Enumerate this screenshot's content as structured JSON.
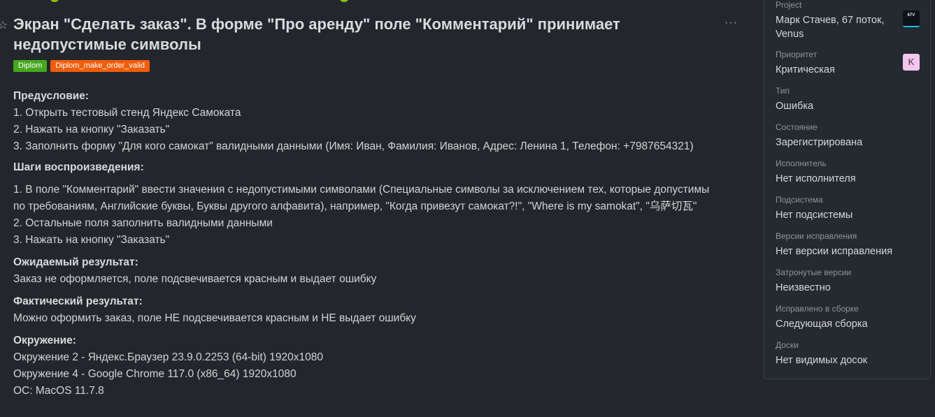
{
  "issue": {
    "title": "Экран \"Сделать заказ\". В форме \"Про аренду\" поле \"Комментарий\" принимает недопустимые символы",
    "more_label": "···",
    "tags": [
      {
        "label": "Diplom",
        "color": "#46a81e"
      },
      {
        "label": "Diplom_make_order_valid",
        "color": "#ef5d0b"
      }
    ]
  },
  "description": {
    "precondition_heading": "Предусловие:",
    "precondition": [
      "1. Открыть тестовый стенд Яндекс Самоката",
      "2. Нажать на кнопку \"Заказать\"",
      "3. Заполнить форму \"Для кого самокат\" валидными данными (Имя: Иван, Фамилия: Иванов, Адрес: Ленина 1, Телефон: +7987654321)"
    ],
    "steps_heading": "Шаги воспроизведения:",
    "steps": [
      "1. В поле \"Комментарий\" ввести значения с недопустимыми символами (Специальные символы за исключением тех, которые допустимы по требованиям, Английские буквы, Буквы другого алфавита), например, \"Когда привезут самокат?!\", \"Where is my samokat\", \"乌萨切瓦\"",
      "2. Остальные поля заполнить валидными данными",
      "3. Нажать на кнопку \"Заказать\""
    ],
    "expected_heading": "Ожидаемый результат:",
    "expected": "Заказ не оформляется, поле подсвечивается красным и выдает ошибку",
    "actual_heading": "Фактический результат:",
    "actual": "Можно оформить заказ, поле НЕ подсвечивается красным и НЕ выдает ошибку",
    "env_heading": "Окружение:",
    "env": [
      "Окружение 2 - Яндекс.Браузер 23.9.0.2253 (64-bit) 1920x1080",
      "Окружение 4 - Google Chrome 117.0 (x86_64) 1920x1080",
      "OC: MacOS 11.7.8"
    ]
  },
  "sidebar": {
    "project": {
      "label": "Project",
      "value": "Марк Стачев, 67 поток, Venus",
      "icon_text": "67V"
    },
    "priority": {
      "label": "Приоритет",
      "value": "Критическая",
      "avatar_letter": "K"
    },
    "type": {
      "label": "Тип",
      "value": "Ошибка"
    },
    "state": {
      "label": "Состояние",
      "value": "Зарегистрирована"
    },
    "assignee": {
      "label": "Исполнитель",
      "value": "Нет исполнителя"
    },
    "subsystem": {
      "label": "Подсистема",
      "value": "Нет подсистемы"
    },
    "fix_versions": {
      "label": "Версии исправления",
      "value": "Нет версии исправления"
    },
    "affected_versions": {
      "label": "Затронутые версии",
      "value": "Неизвестно"
    },
    "fixed_in_build": {
      "label": "Исправлено в сборке",
      "value": "Следующая сборка"
    },
    "boards": {
      "label": "Доски",
      "value": "Нет видимых досок"
    }
  },
  "colors": {
    "background": "#23272b",
    "sidebar_bg": "#242a30",
    "accent_cyan": "#19c0e8"
  }
}
